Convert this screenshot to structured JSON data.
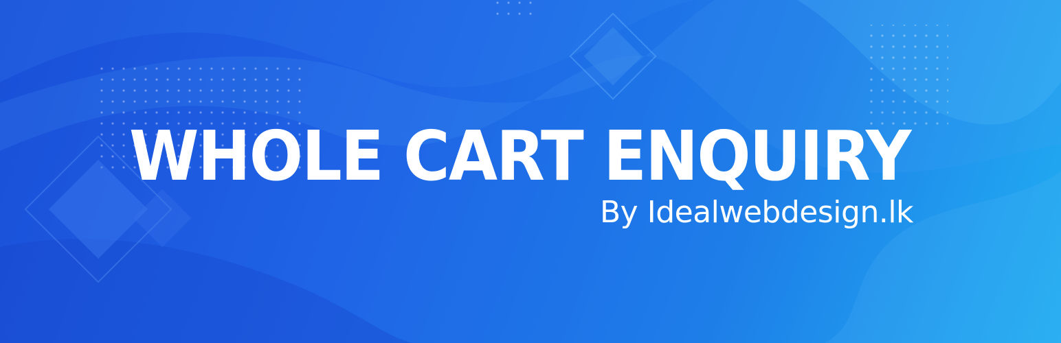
{
  "banner": {
    "title": "WHOLE CART ENQUIRY",
    "subtitle": "By Idealwebdesign.lk"
  },
  "colors": {
    "gradient_start": "#1a4fd8",
    "gradient_mid": "#1f63e6",
    "gradient_end": "#21aff2",
    "text": "#ffffff"
  }
}
